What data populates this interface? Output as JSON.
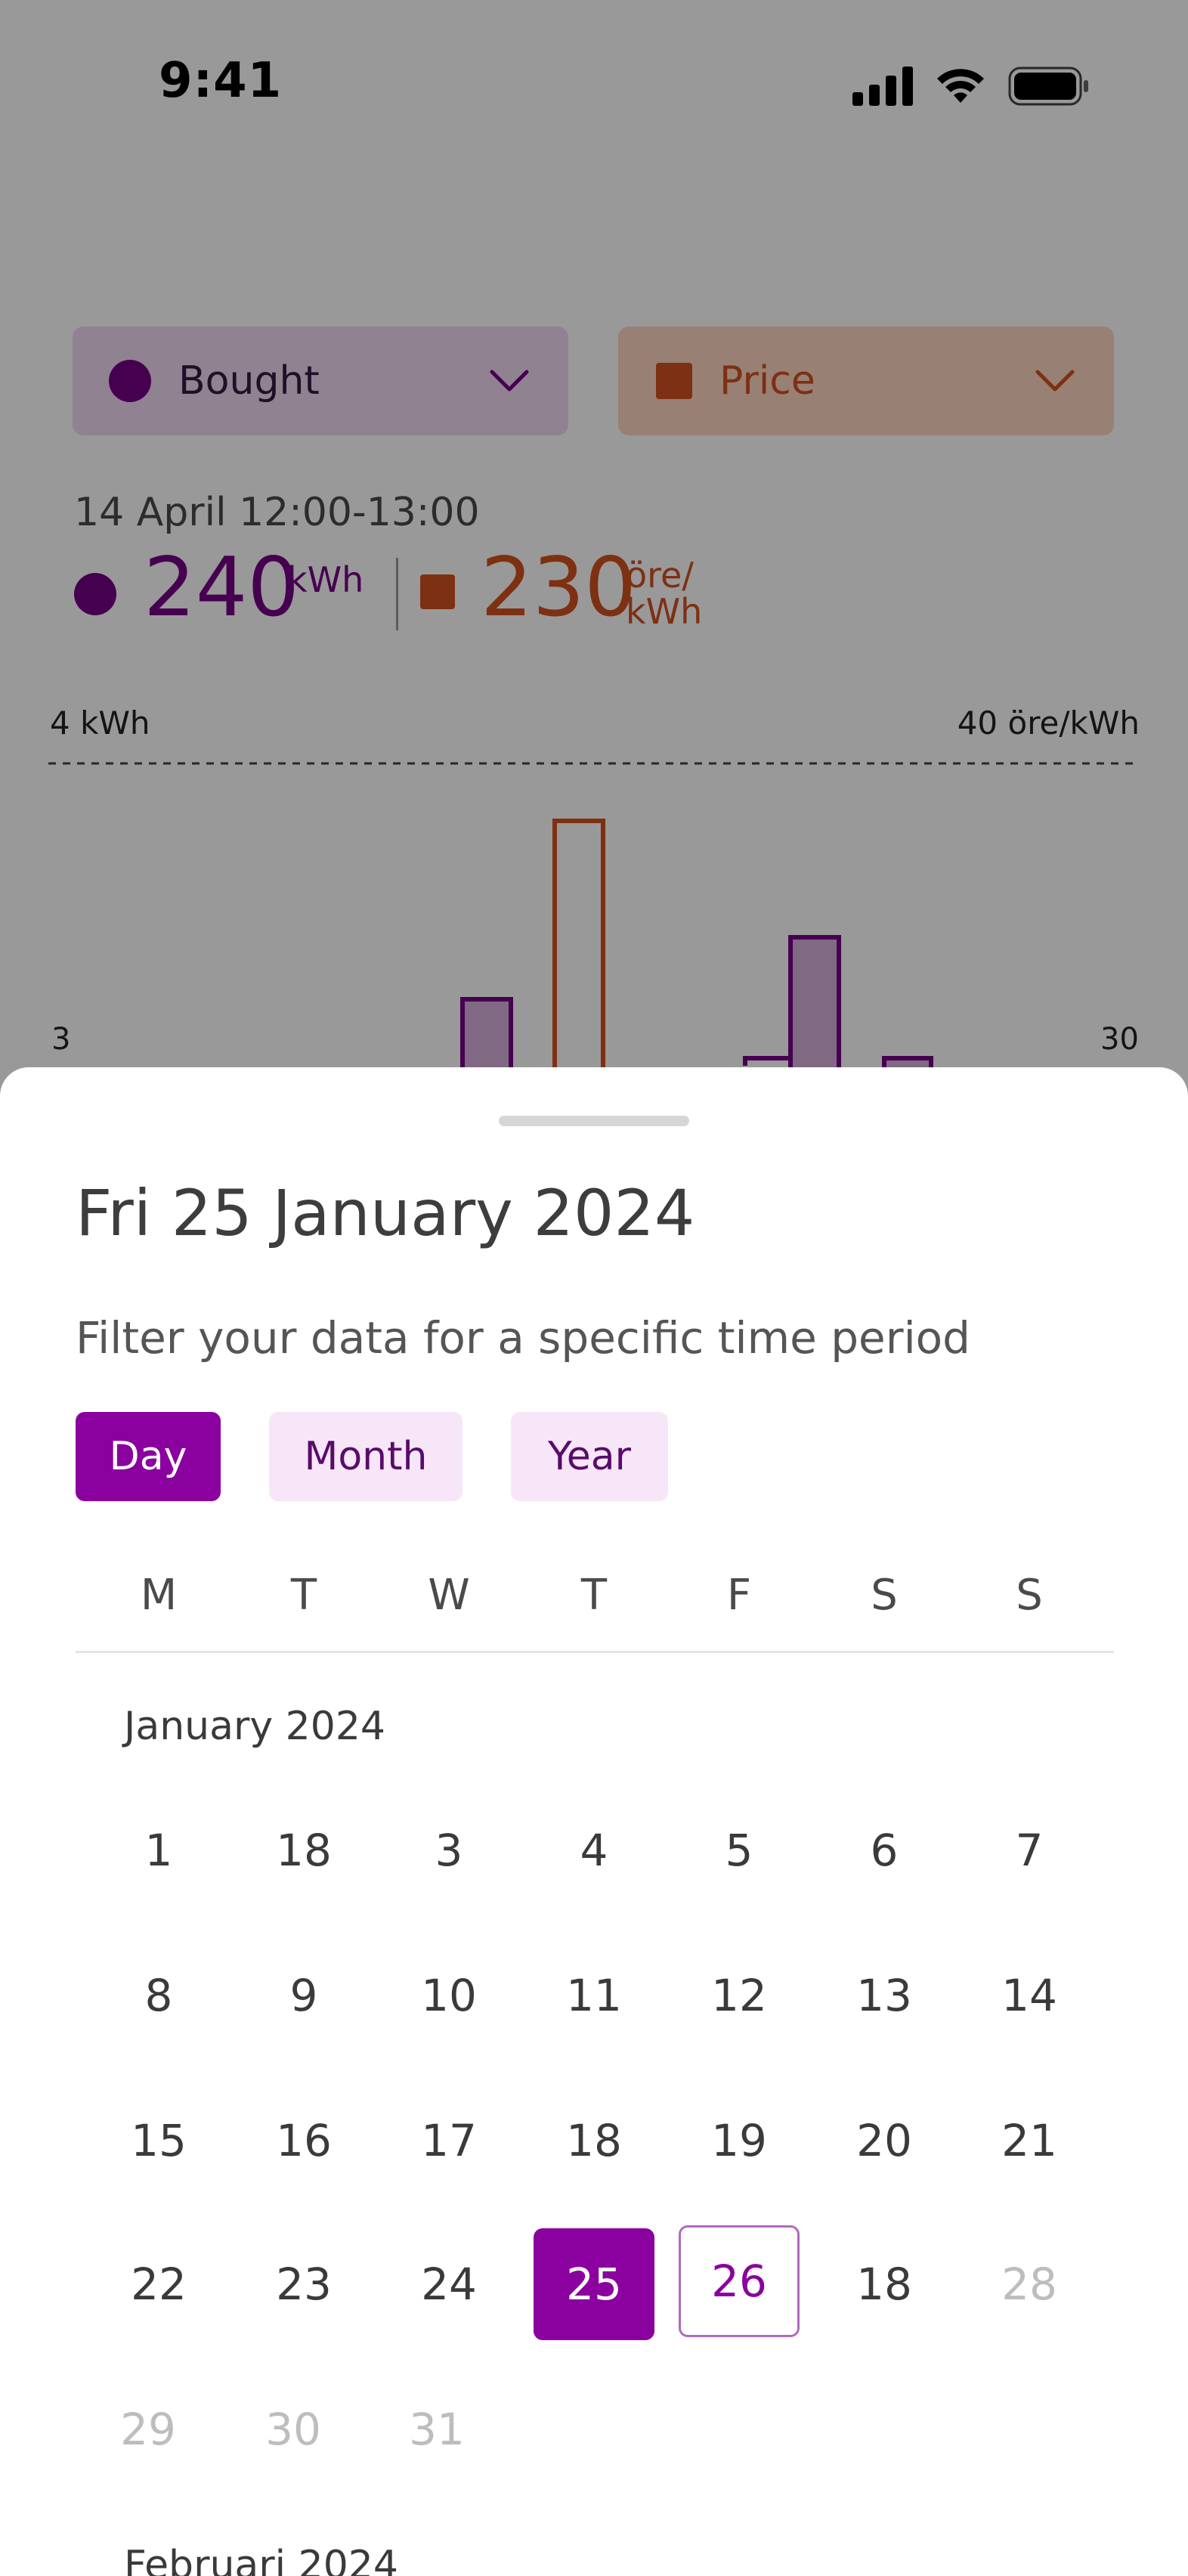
{
  "status": {
    "time": "9:41"
  },
  "filters": {
    "primary": {
      "label": "Bought"
    },
    "secondary": {
      "label": "Price"
    }
  },
  "summary": {
    "date": "14 April 12:00-13:00",
    "bought_value": "240",
    "bought_unit": "kWh",
    "price_value": "230",
    "price_unit_top": "öre/",
    "price_unit_bottom": "kWh"
  },
  "chart_data": {
    "type": "bar",
    "left_axis_ticks": [
      "4 kWh",
      "3"
    ],
    "right_axis_ticks": [
      "40 öre/kWh",
      "30"
    ]
  },
  "sheet": {
    "title": "Fri 25 January 2024",
    "subtitle": "Filter your data for a specific time period",
    "modes": [
      "Day",
      "Month",
      "Year"
    ],
    "active_mode": "Day",
    "weekdays": [
      "M",
      "T",
      "W",
      "T",
      "F",
      "S",
      "S"
    ],
    "month1": "January 2024",
    "month2": "Februari 2024",
    "weeks": [
      [
        "1",
        "18",
        "3",
        "4",
        "5",
        "6",
        "7"
      ],
      [
        "8",
        "9",
        "10",
        "11",
        "12",
        "13",
        "14"
      ],
      [
        "15",
        "16",
        "17",
        "18",
        "19",
        "20",
        "21"
      ],
      [
        "22",
        "23",
        "24",
        "25",
        "26",
        "18",
        "28"
      ],
      [
        "29",
        "30",
        "31"
      ]
    ],
    "selected_day": "25",
    "today": "26"
  },
  "colors": {
    "brand": "#8b01a0",
    "price": "#d2501e",
    "bought": "#760185"
  }
}
